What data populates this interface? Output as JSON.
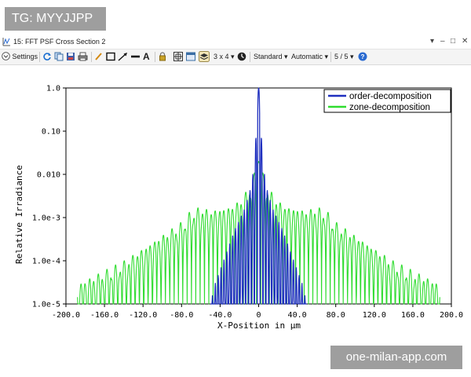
{
  "watermark_top": "TG: MYYJJPP",
  "watermark_bottom": "one-milan-app.com",
  "window": {
    "title": "15: FFT PSF Cross Section 2",
    "controls": [
      "dropdown-arrow",
      "minimize",
      "maximize",
      "close"
    ]
  },
  "toolbar": {
    "settings_label": "Settings",
    "layout_label": "3 x 4",
    "standard_label": "Standard",
    "automatic_label": "Automatic",
    "page_label": "5 / 5",
    "dropdown_marker": "▾",
    "text_tool_label": "A",
    "icons": [
      "refresh-icon",
      "copy-icon",
      "save-icon",
      "print-icon",
      "pencil-icon",
      "rectangle-icon",
      "arrow-icon",
      "line-icon",
      "text-icon",
      "lock-icon",
      "grid-icon",
      "window-icon",
      "layers-icon",
      "clock-icon",
      "help-icon"
    ]
  },
  "chart_data": {
    "type": "line",
    "xlabel": "X-Position in µm",
    "ylabel": "Relative Irradiance",
    "x_ticks": [
      "-200.0",
      "-160.0",
      "-120.0",
      "-80.0",
      "-40.0",
      "0",
      "40.0",
      "80.0",
      "120.0",
      "160.0",
      "200.0"
    ],
    "y_ticks": [
      "1.0",
      "0.10",
      "0.010",
      "1.0e-3",
      "1.0e-4",
      "1.0e-5"
    ],
    "xlim": [
      -200,
      200
    ],
    "ylim": [
      1e-05,
      1
    ],
    "y_scale": "log",
    "grid": false,
    "legend_position": "top-right",
    "series": [
      {
        "name": "order-decomposition",
        "color": "#1f2fbf",
        "x_extent": [
          -50,
          50
        ],
        "peak": 1.0,
        "envelope": [
          [
            0,
            1.0
          ],
          [
            2,
            0.2
          ],
          [
            4,
            0.02
          ],
          [
            8,
            0.005
          ],
          [
            15,
            0.0015
          ],
          [
            25,
            0.0005
          ],
          [
            35,
            0.00012
          ],
          [
            45,
            3e-05
          ],
          [
            50,
            1e-05
          ]
        ],
        "fringe_period": 3
      },
      {
        "name": "zone-decomposition",
        "color": "#2fdc2f",
        "x_extent": [
          -188,
          188
        ],
        "peak": 0.02,
        "envelope": [
          [
            0,
            0.02
          ],
          [
            5,
            0.01
          ],
          [
            10,
            0.005
          ],
          [
            20,
            0.0025
          ],
          [
            30,
            0.0018
          ],
          [
            50,
            0.0015
          ],
          [
            60,
            0.0018
          ],
          [
            70,
            0.0015
          ],
          [
            80,
            0.0008
          ],
          [
            100,
            0.0004
          ],
          [
            120,
            0.0002
          ],
          [
            140,
            0.0001
          ],
          [
            160,
            6e-05
          ],
          [
            188,
            3e-05
          ]
        ],
        "fringe_period": 4.5
      }
    ]
  }
}
